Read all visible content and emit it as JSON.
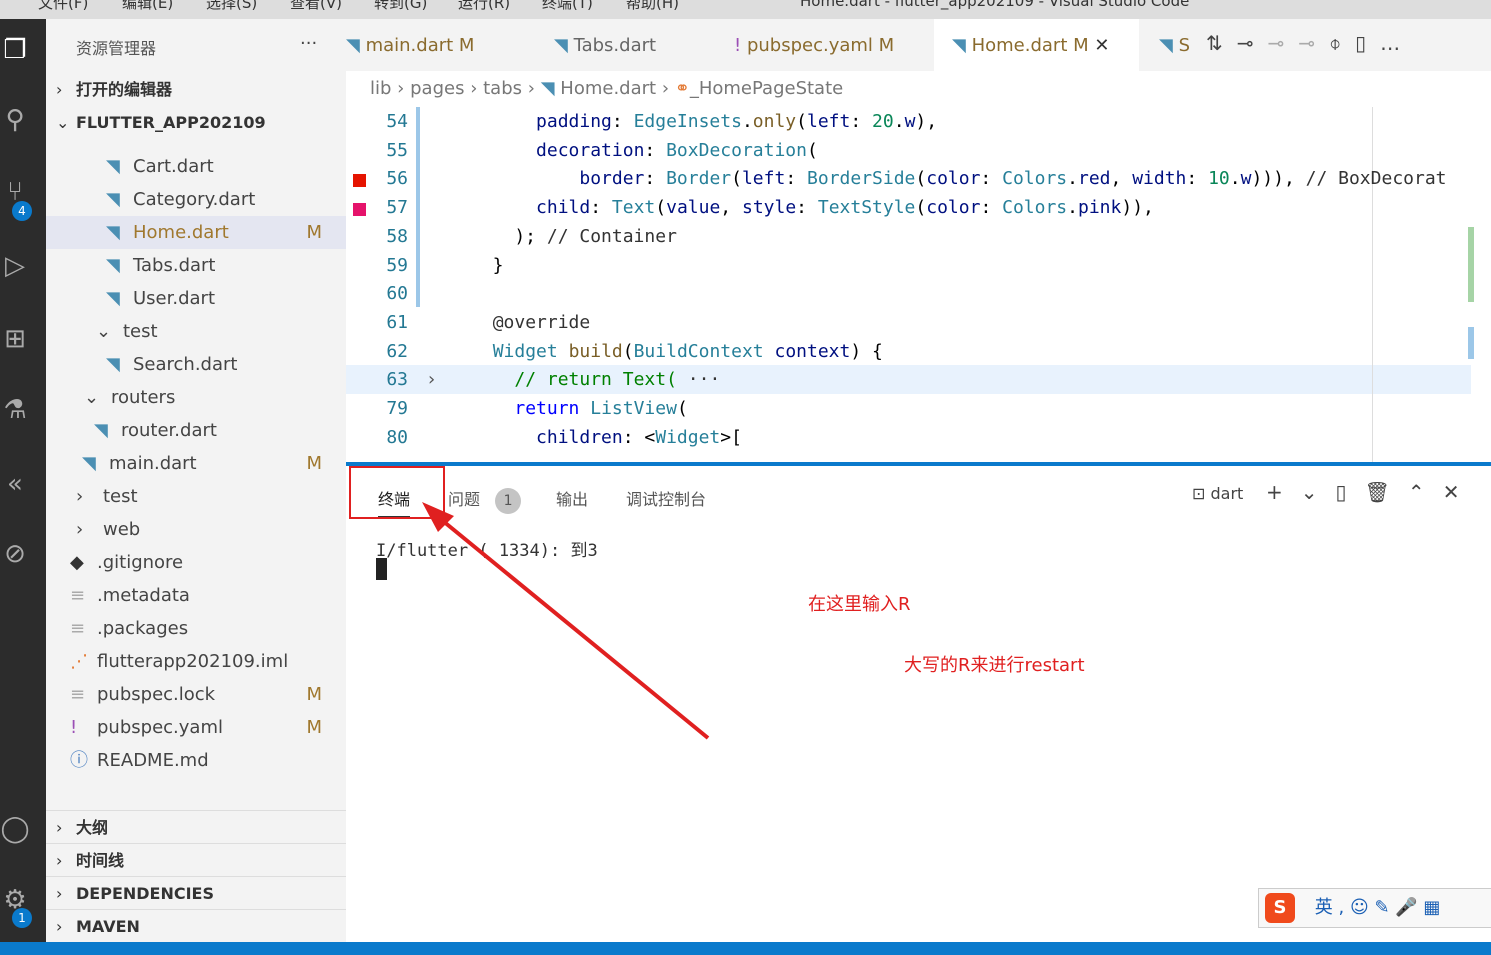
{
  "window": {
    "title": "Home.dart - flutter_app202109 - Visual Studio Code",
    "menu": [
      "文件(F)",
      "编辑(E)",
      "选择(S)",
      "查看(V)",
      "转到(G)",
      "运行(R)",
      "终端(T)",
      "帮助(H)"
    ]
  },
  "activity": {
    "scm_badge": "4",
    "settings_badge": "1"
  },
  "sidebar": {
    "title": "资源管理器",
    "open_editors": "打开的编辑器",
    "project": "FLUTTER_APP202109",
    "items": [
      {
        "label": "Cart.dart",
        "mod": ""
      },
      {
        "label": "Category.dart",
        "mod": ""
      },
      {
        "label": "Home.dart",
        "mod": "M"
      },
      {
        "label": "Tabs.dart",
        "mod": ""
      },
      {
        "label": "User.dart",
        "mod": ""
      },
      {
        "label": "test",
        "mod": ""
      },
      {
        "label": "Search.dart",
        "mod": ""
      },
      {
        "label": "routers",
        "mod": ""
      },
      {
        "label": "router.dart",
        "mod": ""
      },
      {
        "label": "main.dart",
        "mod": "M"
      },
      {
        "label": "test",
        "mod": ""
      },
      {
        "label": "web",
        "mod": ""
      },
      {
        "label": ".gitignore",
        "mod": ""
      },
      {
        "label": ".metadata",
        "mod": ""
      },
      {
        "label": ".packages",
        "mod": ""
      },
      {
        "label": "flutterapp202109.iml",
        "mod": ""
      },
      {
        "label": "pubspec.lock",
        "mod": "M"
      },
      {
        "label": "pubspec.yaml",
        "mod": "M"
      },
      {
        "label": "README.md",
        "mod": ""
      }
    ],
    "sections": [
      "大纲",
      "时间线",
      "DEPENDENCIES",
      "MAVEN"
    ]
  },
  "tabs": [
    {
      "label": "main.dart",
      "mod": "M"
    },
    {
      "label": "Tabs.dart",
      "mod": ""
    },
    {
      "label": "pubspec.yaml",
      "mod": "M"
    },
    {
      "label": "Home.dart",
      "mod": "M"
    },
    {
      "label": "S",
      "mod": ""
    }
  ],
  "breadcrumb": [
    "lib",
    "pages",
    "tabs",
    "Home.dart",
    "_HomePageState"
  ],
  "editor": {
    "lines": [
      {
        "n": "54",
        "html": "      <span class='pr'>padding</span>: <span class='ty'>EdgeInsets</span>.<span class='fn'>only</span>(<span class='pr'>left</span>: <span class='nm'>20</span>.<span class='pr'>w</span>),"
      },
      {
        "n": "55",
        "html": "      <span class='pr'>decoration</span>: <span class='ty'>BoxDecoration</span>("
      },
      {
        "n": "56",
        "html": "          <span class='pr'>border</span>: <span class='ty'>Border</span>(<span class='pr'>left</span>: <span class='ty'>BorderSide</span>(<span class='pr'>color</span>: <span class='ty'>Colors</span>.<span class='pr'>red</span>, <span class='pr'>width</span>: <span class='nm'>10</span>.<span class='pr'>w</span>))), <span class='an'>// BoxDecorat</span>"
      },
      {
        "n": "57",
        "html": "      <span class='pr'>child</span>: <span class='ty'>Text</span>(<span class='pr'>value</span>, <span class='pr'>style</span>: <span class='ty'>TextStyle</span>(<span class='pr'>color</span>: <span class='ty'>Colors</span>.<span class='pr'>pink</span>)),"
      },
      {
        "n": "58",
        "html": "    ); <span class='an'>// Container</span>"
      },
      {
        "n": "59",
        "html": "  }"
      },
      {
        "n": "60",
        "html": ""
      },
      {
        "n": "61",
        "html": "  <span class='an'>@override</span>"
      },
      {
        "n": "62",
        "html": "  <span class='ty'>Widget</span> <span class='fn'>build</span>(<span class='ty'>BuildContext</span> <span class='pr'>context</span>) {"
      },
      {
        "n": "63",
        "html": "    <span class='cm'>// return Text(</span> <span class='an'>···</span>"
      },
      {
        "n": "79",
        "html": "    <span class='kw'>return</span> <span class='ty'>ListView</span>("
      },
      {
        "n": "80",
        "html": "      <span class='pr'>children</span>: &lt;<span class='ty'>Widget</span>&gt;["
      }
    ]
  },
  "panel": {
    "tabs": [
      "终端",
      "问题",
      "输出",
      "调试控制台"
    ],
    "problems_count": "1",
    "terminal_name": "dart",
    "output": "I/flutter ( 1334): 到3"
  },
  "annotations": [
    "在这里输入R",
    "大写的R来进行restart"
  ],
  "ime": {
    "lang": "英"
  },
  "colors": {
    "accent": "#0a7acc",
    "annotation": "#e02020"
  }
}
